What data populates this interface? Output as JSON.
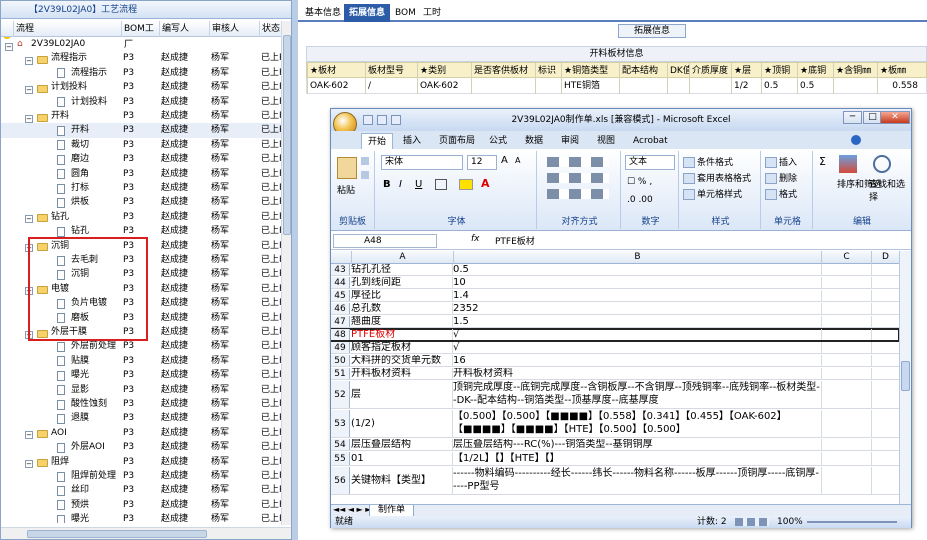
{
  "left_panel": {
    "title": "【2V39L02JA0】工艺流程",
    "headers": [
      "流程",
      "BOM工厂",
      "编写人",
      "审核人",
      "状态"
    ],
    "rows": [
      {
        "label": "2V39L02JA0",
        "level": 0,
        "type": "root",
        "expander": "−",
        "bom": "",
        "author": "",
        "reviewer": "",
        "status": ""
      },
      {
        "label": "流程指示",
        "level": 1,
        "type": "folder",
        "expander": "−",
        "bom": "P3",
        "author": "赵成捷",
        "reviewer": "杨军",
        "status": "已上R"
      },
      {
        "label": "流程指示",
        "level": 2,
        "type": "doc",
        "expander": "",
        "bom": "P3",
        "author": "赵成捷",
        "reviewer": "杨军",
        "status": "已上R"
      },
      {
        "label": "计划投料",
        "level": 1,
        "type": "folder",
        "expander": "−",
        "bom": "P3",
        "author": "赵成捷",
        "reviewer": "杨军",
        "status": "已上R"
      },
      {
        "label": "计划投料",
        "level": 2,
        "type": "doc",
        "expander": "",
        "bom": "P3",
        "author": "赵成捷",
        "reviewer": "杨军",
        "status": "已上R"
      },
      {
        "label": "开料",
        "level": 1,
        "type": "folder",
        "expander": "−",
        "bom": "P3",
        "author": "赵成捷",
        "reviewer": "杨军",
        "status": "已上R"
      },
      {
        "label": "开料",
        "level": 2,
        "type": "doc",
        "expander": "",
        "bom": "P3",
        "author": "赵成捷",
        "reviewer": "杨军",
        "status": "已上R"
      },
      {
        "label": "裁切",
        "level": 2,
        "type": "doc",
        "expander": "",
        "bom": "P3",
        "author": "赵成捷",
        "reviewer": "杨军",
        "status": "已上R"
      },
      {
        "label": "磨边",
        "level": 2,
        "type": "doc",
        "expander": "",
        "bom": "P3",
        "author": "赵成捷",
        "reviewer": "杨军",
        "status": "已上R"
      },
      {
        "label": "圆角",
        "level": 2,
        "type": "doc",
        "expander": "",
        "bom": "P3",
        "author": "赵成捷",
        "reviewer": "杨军",
        "status": "已上R"
      },
      {
        "label": "打标",
        "level": 2,
        "type": "doc",
        "expander": "",
        "bom": "P3",
        "author": "赵成捷",
        "reviewer": "杨军",
        "status": "已上R"
      },
      {
        "label": "烘板",
        "level": 2,
        "type": "doc",
        "expander": "",
        "bom": "P3",
        "author": "赵成捷",
        "reviewer": "杨军",
        "status": "已上R"
      },
      {
        "label": "钻孔",
        "level": 1,
        "type": "folder",
        "expander": "−",
        "bom": "P3",
        "author": "赵成捷",
        "reviewer": "杨军",
        "status": "已上R"
      },
      {
        "label": "钻孔",
        "level": 2,
        "type": "doc",
        "expander": "",
        "bom": "P3",
        "author": "赵成捷",
        "reviewer": "杨军",
        "status": "已上R"
      },
      {
        "label": "沉铜",
        "level": 1,
        "type": "folder",
        "expander": "−",
        "bom": "P3",
        "author": "赵成捷",
        "reviewer": "杨军",
        "status": "已上R"
      },
      {
        "label": "去毛刺",
        "level": 2,
        "type": "doc",
        "expander": "",
        "bom": "P3",
        "author": "赵成捷",
        "reviewer": "杨军",
        "status": "已上R"
      },
      {
        "label": "沉铜",
        "level": 2,
        "type": "doc",
        "expander": "",
        "bom": "P3",
        "author": "赵成捷",
        "reviewer": "杨军",
        "status": "已上R"
      },
      {
        "label": "电镀",
        "level": 1,
        "type": "folder",
        "expander": "−",
        "bom": "P3",
        "author": "赵成捷",
        "reviewer": "杨军",
        "status": "已上R"
      },
      {
        "label": "负片电镀",
        "level": 2,
        "type": "doc",
        "expander": "",
        "bom": "P3",
        "author": "赵成捷",
        "reviewer": "杨军",
        "status": "已上R"
      },
      {
        "label": "磨板",
        "level": 2,
        "type": "doc",
        "expander": "",
        "bom": "P3",
        "author": "赵成捷",
        "reviewer": "杨军",
        "status": "已上R"
      },
      {
        "label": "外层干膜",
        "level": 1,
        "type": "folder",
        "expander": "−",
        "bom": "P3",
        "author": "赵成捷",
        "reviewer": "杨军",
        "status": "已上R"
      },
      {
        "label": "外层前处理",
        "level": 2,
        "type": "doc",
        "expander": "",
        "bom": "P3",
        "author": "赵成捷",
        "reviewer": "杨军",
        "status": "已上R"
      },
      {
        "label": "贴膜",
        "level": 2,
        "type": "doc",
        "expander": "",
        "bom": "P3",
        "author": "赵成捷",
        "reviewer": "杨军",
        "status": "已上R"
      },
      {
        "label": "曝光",
        "level": 2,
        "type": "doc",
        "expander": "",
        "bom": "P3",
        "author": "赵成捷",
        "reviewer": "杨军",
        "status": "已上R"
      },
      {
        "label": "显影",
        "level": 2,
        "type": "doc",
        "expander": "",
        "bom": "P3",
        "author": "赵成捷",
        "reviewer": "杨军",
        "status": "已上R"
      },
      {
        "label": "酸性蚀刻",
        "level": 2,
        "type": "doc",
        "expander": "",
        "bom": "P3",
        "author": "赵成捷",
        "reviewer": "杨军",
        "status": "已上R"
      },
      {
        "label": "退膜",
        "level": 2,
        "type": "doc",
        "expander": "",
        "bom": "P3",
        "author": "赵成捷",
        "reviewer": "杨军",
        "status": "已上R"
      },
      {
        "label": "AOI",
        "level": 1,
        "type": "folder",
        "expander": "−",
        "bom": "P3",
        "author": "赵成捷",
        "reviewer": "杨军",
        "status": "已上R"
      },
      {
        "label": "外层AOI",
        "level": 2,
        "type": "doc",
        "expander": "",
        "bom": "P3",
        "author": "赵成捷",
        "reviewer": "杨军",
        "status": "已上R"
      },
      {
        "label": "阻焊",
        "level": 1,
        "type": "folder",
        "expander": "−",
        "bom": "P3",
        "author": "赵成捷",
        "reviewer": "杨军",
        "status": "已上R"
      },
      {
        "label": "阻焊前处理",
        "level": 2,
        "type": "doc",
        "expander": "",
        "bom": "P3",
        "author": "赵成捷",
        "reviewer": "杨军",
        "status": "已上R"
      },
      {
        "label": "丝印",
        "level": 2,
        "type": "doc",
        "expander": "",
        "bom": "P3",
        "author": "赵成捷",
        "reviewer": "杨军",
        "status": "已上R"
      },
      {
        "label": "预烘",
        "level": 2,
        "type": "doc",
        "expander": "",
        "bom": "P3",
        "author": "赵成捷",
        "reviewer": "杨军",
        "status": "已上R"
      },
      {
        "label": "曝光",
        "level": 2,
        "type": "doc",
        "expander": "",
        "bom": "P3",
        "author": "赵成捷",
        "reviewer": "杨军",
        "status": "已上R"
      }
    ]
  },
  "right_panel": {
    "tabs": [
      "基本信息",
      "拓展信息",
      "BOM",
      "工时"
    ],
    "active_tab": 1,
    "subtab": "拓展信息",
    "group_title": "开料板材信息",
    "grid_headers": [
      "★板材",
      "板材型号",
      "★类别",
      "是否客供板材",
      "标识",
      "★铜箔类型",
      "配本结构",
      "DK值",
      "介质厚度",
      "★层",
      "★顶铜",
      "★底铜",
      "★含铜㎜",
      "★板㎜"
    ],
    "grid_row": [
      "OAK-602",
      "/",
      "OAK-602",
      "",
      "",
      "HTE铜箔",
      "",
      "",
      "",
      "1/2",
      "0.5",
      "0.5",
      "",
      "0.558"
    ]
  },
  "excel": {
    "title": "2V39L02JA0制作单.xls [兼容模式] - Microsoft Excel",
    "window_buttons": [
      "─",
      "□",
      "✕"
    ],
    "ribbon_tabs": [
      "开始",
      "插入",
      "页面布局",
      "公式",
      "数据",
      "审阅",
      "视图",
      "Acrobat"
    ],
    "font_name": "宋体",
    "font_size": "12",
    "number_format": "文本",
    "groups": [
      "剪贴板",
      "字体",
      "对齐方式",
      "数字",
      "样式",
      "单元格",
      "编辑"
    ],
    "paste_label": "粘贴",
    "style_buttons": [
      "条件格式",
      "套用表格格式",
      "单元格样式"
    ],
    "cell_buttons": [
      "插入",
      "删除",
      "格式"
    ],
    "edit_buttons": [
      "排序和筛选",
      "查找和选择"
    ],
    "name_box": "A48",
    "fx": "fx",
    "formula_value": "PTFE板材",
    "columns": [
      "A",
      "B",
      "C",
      "D"
    ],
    "rows": [
      {
        "n": "43",
        "a": "钻孔孔径",
        "b": "0.5",
        "h": 12
      },
      {
        "n": "44",
        "a": "孔到线间距",
        "b": "10",
        "h": 12
      },
      {
        "n": "45",
        "a": "厚径比",
        "b": "1.4",
        "h": 12
      },
      {
        "n": "46",
        "a": "总孔数",
        "b": "2352",
        "h": 12
      },
      {
        "n": "47",
        "a": "翘曲度",
        "b": "1.5",
        "h": 12
      },
      {
        "n": "48",
        "a": "PTFE板材",
        "b": "√",
        "h": 12,
        "red": true
      },
      {
        "n": "49",
        "a": "顾客指定板材",
        "b": "√",
        "h": 12
      },
      {
        "n": "50",
        "a": "大料拼的交货单元数",
        "b": "16",
        "h": 12
      },
      {
        "n": "51",
        "a": "开料板材资料",
        "b": "开料板材资料",
        "h": 12
      },
      {
        "n": "52",
        "a": "层",
        "b": "顶铜完成厚度--底铜完成厚度--含铜板厚--不含铜厚--顶残铜率--底残铜率--板材类型--DK--配本结构--铜箔类型--顶基厚度--底基厚度",
        "h": 28
      },
      {
        "n": "53",
        "a": "(1/2)",
        "b": "【0.500】【0.500】【■■■■】【0.558】【0.341】【0.455】【OAK-602】【■■■■】【■■■■】【HTE】【0.500】【0.500】",
        "h": 28
      },
      {
        "n": "54",
        "a": "层压叠层结构",
        "b": "层压叠层结构---RC(%)---铜箔类型--基铜铜厚",
        "h": 12
      },
      {
        "n": "55",
        "a": "01",
        "b": "【1/2L】【】【HTE】【】",
        "h": 14
      },
      {
        "n": "56",
        "a": "关键物料【类型】",
        "b": "------物料编码----------经长------纬长------物料名称------板厚------顶铜厚-----底铜厚-----PP型号",
        "h": 28
      }
    ],
    "sheet_tab": "制作单",
    "status_left": "就绪",
    "status_count": "计数: 2",
    "zoom": "100%"
  }
}
